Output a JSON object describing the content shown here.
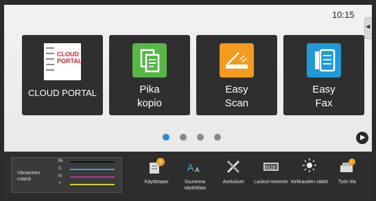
{
  "status": {
    "time": "10:15"
  },
  "tiles": [
    {
      "label_line1": "CLOUD PORTAL",
      "label_line2": "",
      "icon": "cloud-portal-icon",
      "logo_text": "CLOUD PORTAL"
    },
    {
      "label_line1": "Pika",
      "label_line2": "kopio",
      "icon": "copy-icon",
      "color": "#58b548"
    },
    {
      "label_line1": "Easy",
      "label_line2": "Scan",
      "icon": "scan-icon",
      "color": "#f39c1f"
    },
    {
      "label_line1": "Easy",
      "label_line2": "Fax",
      "icon": "fax-icon",
      "color": "#1f9ad6"
    }
  ],
  "pager": {
    "pages": 4,
    "active": 1
  },
  "toner": {
    "label": "Väriaineen määrä",
    "colors": [
      {
        "key": "Bk",
        "color": "#111111"
      },
      {
        "key": "C",
        "color": "#29b0d8"
      },
      {
        "key": "M",
        "color": "#b23c93"
      },
      {
        "key": "Y",
        "color": "#c8d23a"
      }
    ]
  },
  "bottom_buttons": [
    {
      "label": "Käyttöopas",
      "icon": "manual-icon"
    },
    {
      "label": "Suurenna näyttötilaa",
      "icon": "enlarge-display-icon"
    },
    {
      "label": "Asetukset",
      "icon": "settings-tools-icon"
    },
    {
      "label": "Laskuri-toiminto",
      "icon": "counter-icon"
    },
    {
      "label": "Kirkkauden säätö",
      "icon": "brightness-icon"
    },
    {
      "label": "Työn tila",
      "icon": "job-status-icon"
    }
  ]
}
